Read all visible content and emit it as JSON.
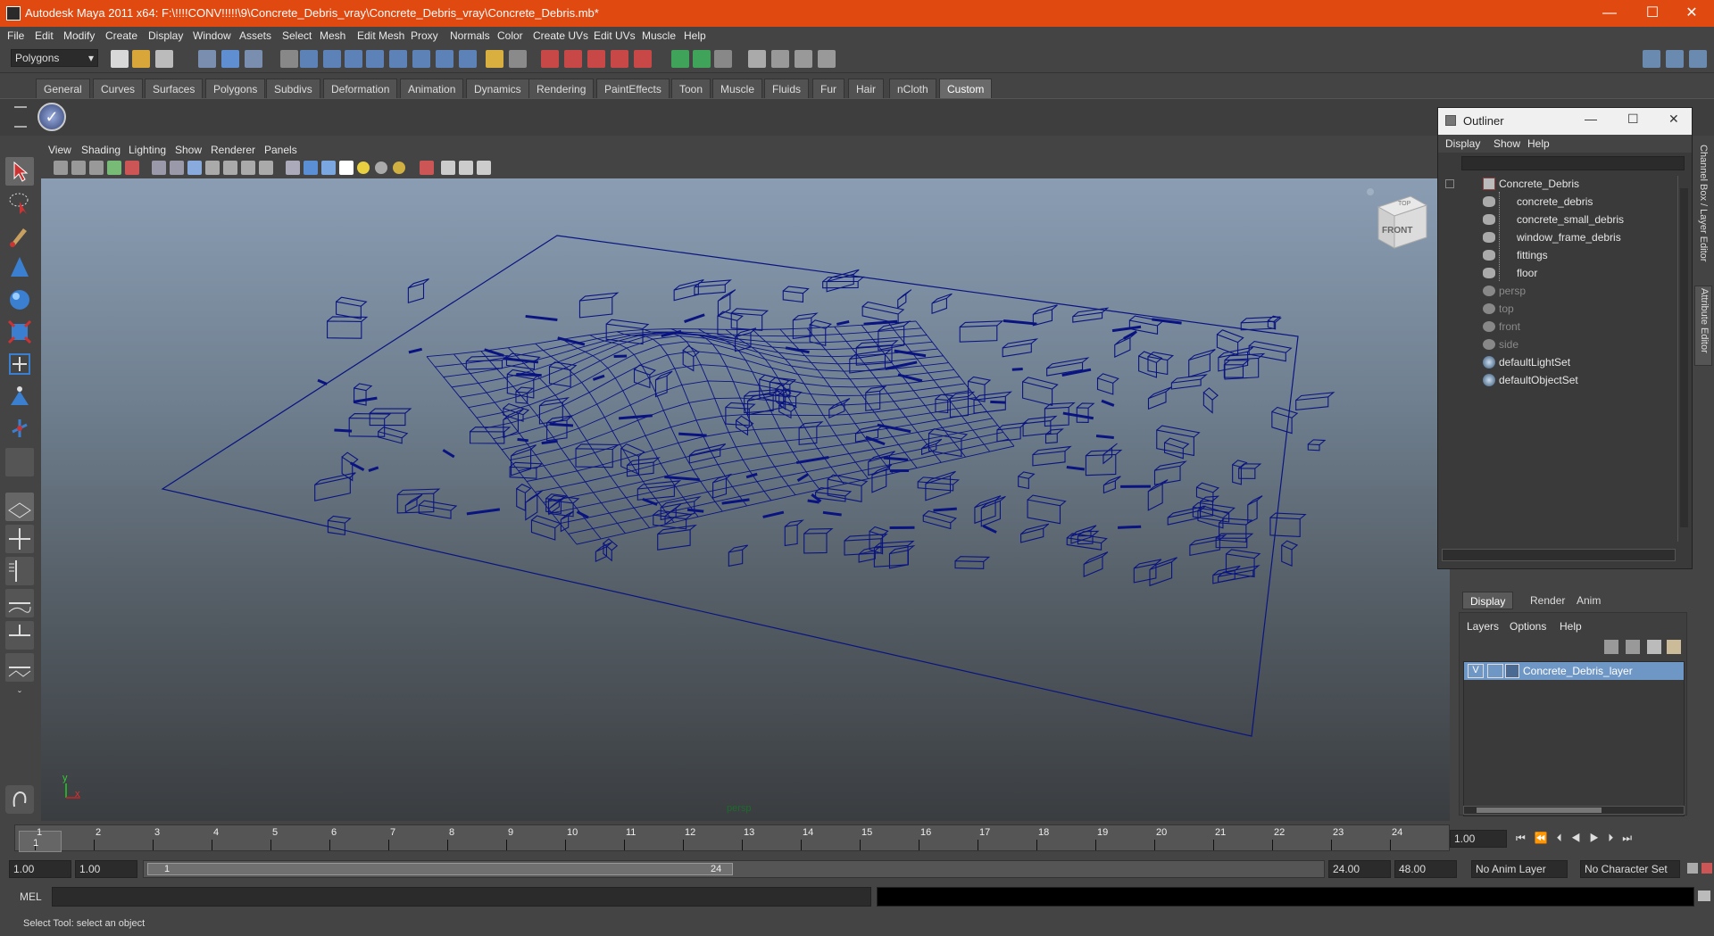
{
  "window": {
    "title": "Autodesk Maya 2011 x64: F:\\!!!!CONV!!!!!\\9\\Concrete_Debris_vray\\Concrete_Debris_vray\\Concrete_Debris.mb*",
    "minimize": "—",
    "maximize": "☐",
    "close": "✕"
  },
  "menubar": [
    "File",
    "Edit",
    "Modify",
    "Create",
    "Display",
    "Window",
    "Assets",
    "Select",
    "Mesh",
    "Edit Mesh",
    "Proxy",
    "Normals",
    "Color",
    "Create UVs",
    "Edit UVs",
    "Muscle",
    "Help"
  ],
  "status_line": {
    "mode": "Polygons"
  },
  "shelf": {
    "tabs": [
      "General",
      "Curves",
      "Surfaces",
      "Polygons",
      "Subdivs",
      "Deformation",
      "Animation",
      "Dynamics",
      "Rendering",
      "PaintEffects",
      "Toon",
      "Muscle",
      "Fluids",
      "Fur",
      "Hair",
      "nCloth",
      "Custom"
    ],
    "active_tab": "Custom"
  },
  "panel": {
    "menus": [
      "View",
      "Shading",
      "Lighting",
      "Show",
      "Renderer",
      "Panels"
    ],
    "camera_label": "persp",
    "viewcube_top": "TOP",
    "viewcube_front": "FRONT",
    "axis_y": "y",
    "axis_x": "x"
  },
  "outliner": {
    "title": "Outliner",
    "menus": [
      "Display",
      "Show",
      "Help"
    ],
    "items": [
      {
        "label": "Concrete_Debris",
        "dim": false
      },
      {
        "label": "concrete_debris",
        "dim": false
      },
      {
        "label": "concrete_small_debris",
        "dim": false
      },
      {
        "label": "window_frame_debris",
        "dim": false
      },
      {
        "label": "fittings",
        "dim": false
      },
      {
        "label": "floor",
        "dim": false
      },
      {
        "label": "persp",
        "dim": true
      },
      {
        "label": "top",
        "dim": true
      },
      {
        "label": "front",
        "dim": true
      },
      {
        "label": "side",
        "dim": true
      },
      {
        "label": "defaultLightSet",
        "dim": false
      },
      {
        "label": "defaultObjectSet",
        "dim": false
      }
    ]
  },
  "side_tabs": {
    "channel_box": "Channel Box / Layer Editor",
    "attribute_editor": "Attribute Editor"
  },
  "layer_editor": {
    "tabs": [
      "Display",
      "Render",
      "Anim"
    ],
    "active_tab": "Display",
    "menus": [
      "Layers",
      "Options",
      "Help"
    ],
    "layer_visible": "V",
    "layer_name": "Concrete_Debris_layer"
  },
  "time_slider": {
    "ticks": [
      "1",
      "2",
      "3",
      "4",
      "5",
      "6",
      "7",
      "8",
      "9",
      "10",
      "11",
      "12",
      "13",
      "14",
      "15",
      "16",
      "17",
      "18",
      "19",
      "20",
      "21",
      "22",
      "23",
      "24"
    ],
    "current_frame_marker": "1",
    "current_time": "1.00"
  },
  "range_slider": {
    "start_time": "1.00",
    "playback_start": "1.00",
    "range_start_label": "1",
    "range_end_label": "24",
    "playback_end": "24.00",
    "end_time": "48.00",
    "anim_layer": "No Anim Layer",
    "character_set": "No Character Set"
  },
  "command_line": {
    "label": "MEL"
  },
  "help_line": {
    "text": "Select Tool: select an object"
  },
  "colors": {
    "title_bar": "#e04910",
    "ui_bg": "#444444",
    "wire": "#0a1480",
    "selection": "#6f97c6"
  }
}
